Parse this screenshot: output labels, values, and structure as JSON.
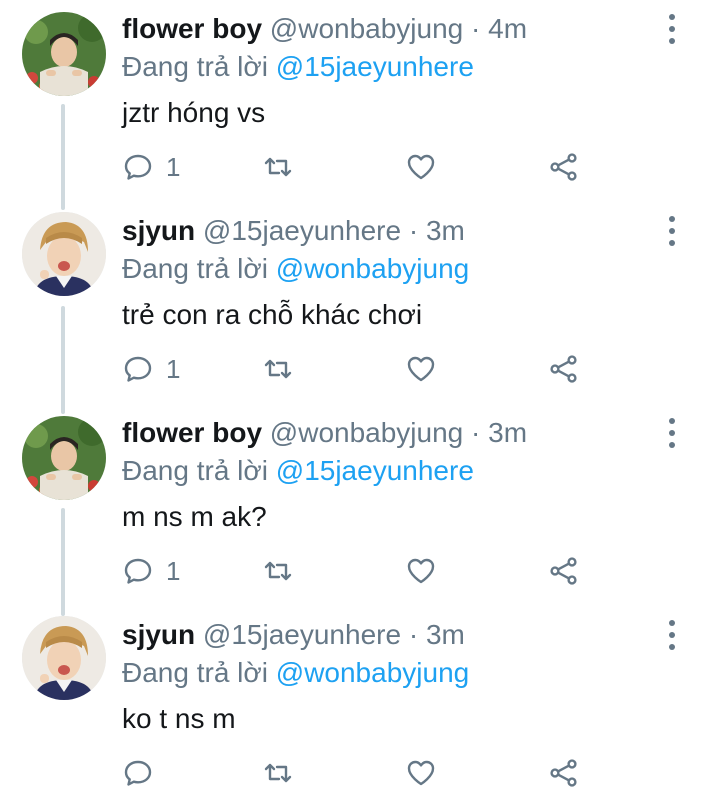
{
  "colors": {
    "name": "#14171a",
    "meta": "#657786",
    "mention": "#1da1f2",
    "thread_line": "#cfd9de",
    "background": "#ffffff"
  },
  "icons": {
    "reply": "speech-bubble-icon",
    "retweet": "retweet-arrows-icon",
    "like": "heart-outline-icon",
    "share": "share-nodes-icon",
    "more": "vertical-dots-icon"
  },
  "tweets": [
    {
      "name": "flower boy",
      "handle": "@wonbabyjung",
      "dot": "·",
      "time": "4m",
      "replying_prefix": "Đang trả lời",
      "replying_to": "@15jaeyunhere",
      "text": "jztr hóng vs",
      "reply_count": "1"
    },
    {
      "name": "sjyun",
      "handle": "@15jaeyunhere",
      "dot": "·",
      "time": "3m",
      "replying_prefix": "Đang trả lời",
      "replying_to": "@wonbabyjung",
      "text": "trẻ con ra chỗ khác chơi",
      "reply_count": "1"
    },
    {
      "name": "flower boy",
      "handle": "@wonbabyjung",
      "dot": "·",
      "time": "3m",
      "replying_prefix": "Đang trả lời",
      "replying_to": "@15jaeyunhere",
      "text": "m ns m ak?",
      "reply_count": "1"
    },
    {
      "name": "sjyun",
      "handle": "@15jaeyunhere",
      "dot": "·",
      "time": "3m",
      "replying_prefix": "Đang trả lời",
      "replying_to": "@wonbabyjung",
      "text": "ko t ns m",
      "reply_count": ""
    }
  ]
}
